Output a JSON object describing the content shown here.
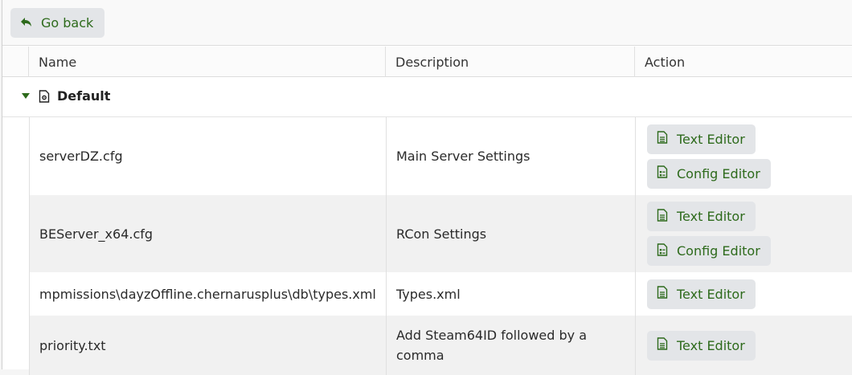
{
  "toolbar": {
    "back_label": "Go back"
  },
  "table": {
    "headers": {
      "name": "Name",
      "description": "Description",
      "action": "Action"
    },
    "group": {
      "title": "Default"
    },
    "rows": [
      {
        "name": "serverDZ.cfg",
        "description": "Main Server Settings",
        "actions": [
          "Text Editor",
          "Config Editor"
        ]
      },
      {
        "name": "BEServer_x64.cfg",
        "description": "RCon Settings",
        "actions": [
          "Text Editor",
          "Config Editor"
        ]
      },
      {
        "name": "mpmissions\\dayzOffline.chernarusplus\\db\\types.xml",
        "description": "Types.xml",
        "actions": [
          "Text Editor"
        ]
      },
      {
        "name": "priority.txt",
        "description": "Add Steam64ID followed by a comma",
        "actions": [
          "Text Editor"
        ]
      }
    ]
  },
  "icons": {
    "back": "reply-arrow-icon",
    "group": "settings-file-icon",
    "text_editor": "text-file-icon",
    "config_editor": "form-file-icon"
  },
  "colors": {
    "accent": "#2d6a1b",
    "button_bg": "#e3e5e8",
    "alt_row": "#f1f1f1"
  }
}
